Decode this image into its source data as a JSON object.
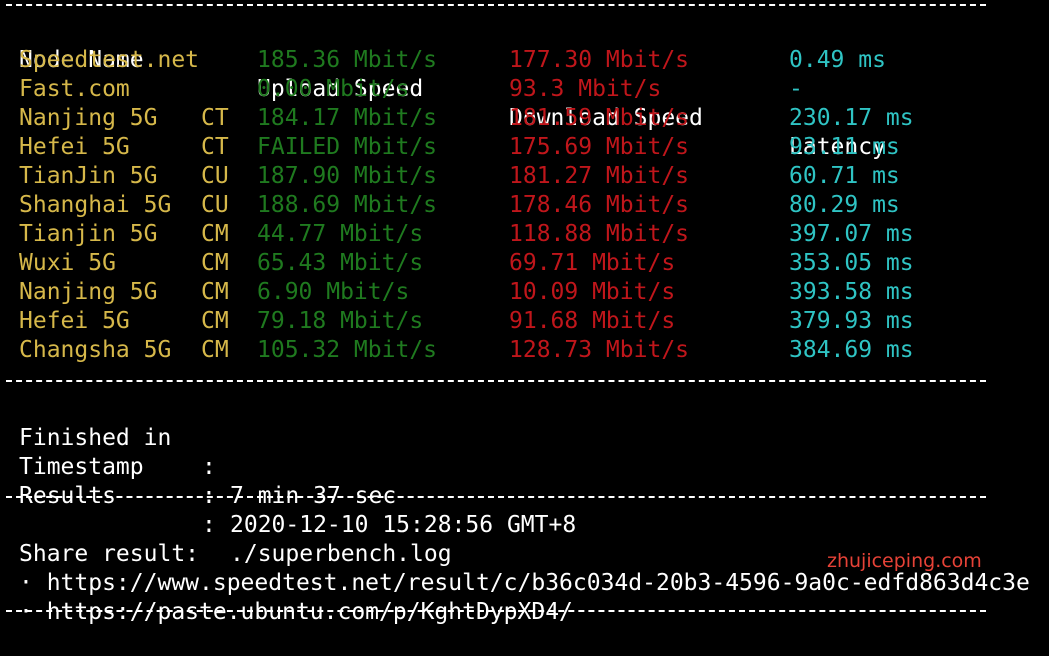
{
  "headers": {
    "node_name": "Node Name",
    "upload_speed": "Upload Speed",
    "download_speed": "Download Speed",
    "latency": "Latency"
  },
  "rows": [
    {
      "name": "Speedtest.net",
      "isp": "",
      "upload": "185.36 Mbit/s",
      "download": "177.30 Mbit/s",
      "latency": "0.49 ms"
    },
    {
      "name": "Fast.com",
      "isp": "",
      "upload": "0.00 Mbit/s",
      "download": "93.3 Mbit/s",
      "latency": "-"
    },
    {
      "name": "Nanjing 5G",
      "isp": "CT",
      "upload": "184.17 Mbit/s",
      "download": "181.59 Mbit/s",
      "latency": "230.17 ms"
    },
    {
      "name": "Hefei 5G",
      "isp": "CT",
      "upload": "FAILED Mbit/s",
      "download": "175.69 Mbit/s",
      "latency": "93.11 ms"
    },
    {
      "name": "TianJin 5G",
      "isp": "CU",
      "upload": "187.90 Mbit/s",
      "download": "181.27 Mbit/s",
      "latency": "60.71 ms"
    },
    {
      "name": "Shanghai 5G",
      "isp": "CU",
      "upload": "188.69 Mbit/s",
      "download": "178.46 Mbit/s",
      "latency": "80.29 ms"
    },
    {
      "name": "Tianjin 5G",
      "isp": "CM",
      "upload": "44.77 Mbit/s",
      "download": "118.88 Mbit/s",
      "latency": "397.07 ms"
    },
    {
      "name": "Wuxi 5G",
      "isp": "CM",
      "upload": "65.43 Mbit/s",
      "download": "69.71 Mbit/s",
      "latency": "353.05 ms"
    },
    {
      "name": "Nanjing 5G",
      "isp": "CM",
      "upload": "6.90 Mbit/s",
      "download": "10.09 Mbit/s",
      "latency": "393.58 ms"
    },
    {
      "name": "Hefei 5G",
      "isp": "CM",
      "upload": "79.18 Mbit/s",
      "download": "91.68 Mbit/s",
      "latency": "379.93 ms"
    },
    {
      "name": "Changsha 5G",
      "isp": "CM",
      "upload": "105.32 Mbit/s",
      "download": "128.73 Mbit/s",
      "latency": "384.69 ms"
    }
  ],
  "info": {
    "finished_label": "Finished in",
    "finished_value": "7 min 37 sec",
    "timestamp_label": "Timestamp",
    "timestamp_value": "2020-12-10 15:28:56 GMT+8",
    "results_label": "Results",
    "results_value": "./superbench.log",
    "colon": ":"
  },
  "share": {
    "title": "Share result:",
    "links": [
      "· https://www.speedtest.net/result/c/b36c034d-20b3-4596-9a0c-edfd863d4c3e",
      "· https://paste.ubuntu.com/p/KghtDypXD4/"
    ]
  },
  "watermark": "zhujiceping.com",
  "colors": {
    "node_name": "#d6b84a",
    "upload": "#1f7a1f",
    "download": "#c0161b",
    "latency": "#2fc4c4",
    "background": "#000000",
    "watermark": "#ff4a3d"
  }
}
